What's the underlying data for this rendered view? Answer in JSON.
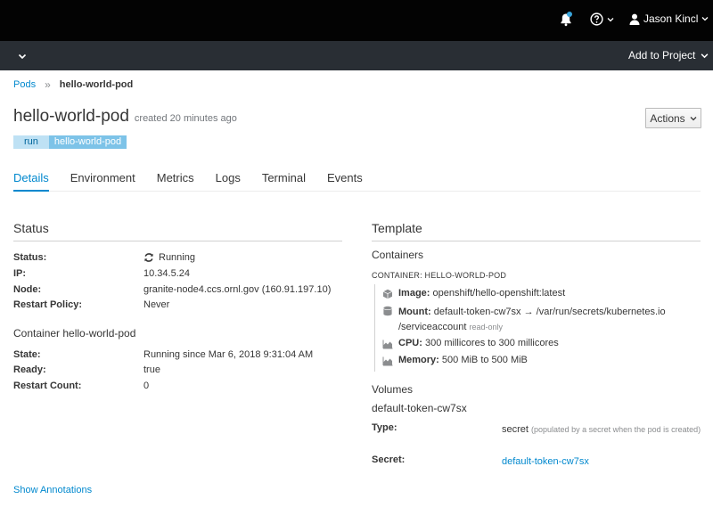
{
  "topbar": {
    "user_name": "Jason Kincl",
    "colors": {
      "background": "#030303",
      "notification_dot": "#39a5dc"
    },
    "icons": {
      "notifications": "bell-icon",
      "help": "question-circle-icon",
      "user": "user-icon",
      "caret": "caret-down-icon"
    }
  },
  "subbar": {
    "add_to_project": "Add to Project"
  },
  "breadcrumb": {
    "parent": "Pods",
    "current": "hello-world-pod"
  },
  "header": {
    "title": "hello-world-pod",
    "created": "created 20 minutes ago",
    "actions_label": "Actions"
  },
  "labels": [
    {
      "key": "run",
      "value": "hello-world-pod"
    }
  ],
  "tabs": [
    {
      "label": "Details",
      "active": true
    },
    {
      "label": "Environment",
      "active": false
    },
    {
      "label": "Metrics",
      "active": false
    },
    {
      "label": "Logs",
      "active": false
    },
    {
      "label": "Terminal",
      "active": false
    },
    {
      "label": "Events",
      "active": false
    }
  ],
  "status_section": {
    "title": "Status",
    "rows": [
      {
        "key": "Status:",
        "value": "Running"
      },
      {
        "key": "IP:",
        "value": "10.34.5.24"
      },
      {
        "key": "Node:",
        "value": "granite-node4.ccs.ornl.gov (160.91.197.10)"
      },
      {
        "key": "Restart Policy:",
        "value": "Never"
      }
    ],
    "container_title": "Container hello-world-pod",
    "container_rows": [
      {
        "key": "State:",
        "value": "Running since Mar 6, 2018 9:31:04 AM"
      },
      {
        "key": "Ready:",
        "value": "true"
      },
      {
        "key": "Restart Count:",
        "value": "0"
      }
    ]
  },
  "template_section": {
    "title": "Template",
    "containers_title": "Containers",
    "container_label": "CONTAINER: HELLO-WORLD-POD",
    "image_key": "Image:",
    "image_value": "openshift/hello-openshift:latest",
    "mount_key": "Mount:",
    "mount_value": "default-token-cw7sx → /var/run/secrets/kubernetes.io",
    "mount_value_cont": "/serviceaccount",
    "mount_note": "read-only",
    "cpu_key": "CPU:",
    "cpu_value": "300 millicores to 300 millicores",
    "memory_key": "Memory:",
    "memory_value": "500 MiB to 500 MiB",
    "volumes_title": "Volumes",
    "volume_name": "default-token-cw7sx",
    "type_key": "Type:",
    "type_value": "secret",
    "type_note": "(populated by a secret when the pod is created)",
    "secret_key": "Secret:",
    "secret_value": "default-token-cw7sx"
  },
  "footer": {
    "show_annotations": "Show Annotations"
  },
  "colors": {
    "accent": "#0088ce",
    "label_key_bg": "#bee1f4",
    "label_value_bg": "#7dc3e8"
  }
}
